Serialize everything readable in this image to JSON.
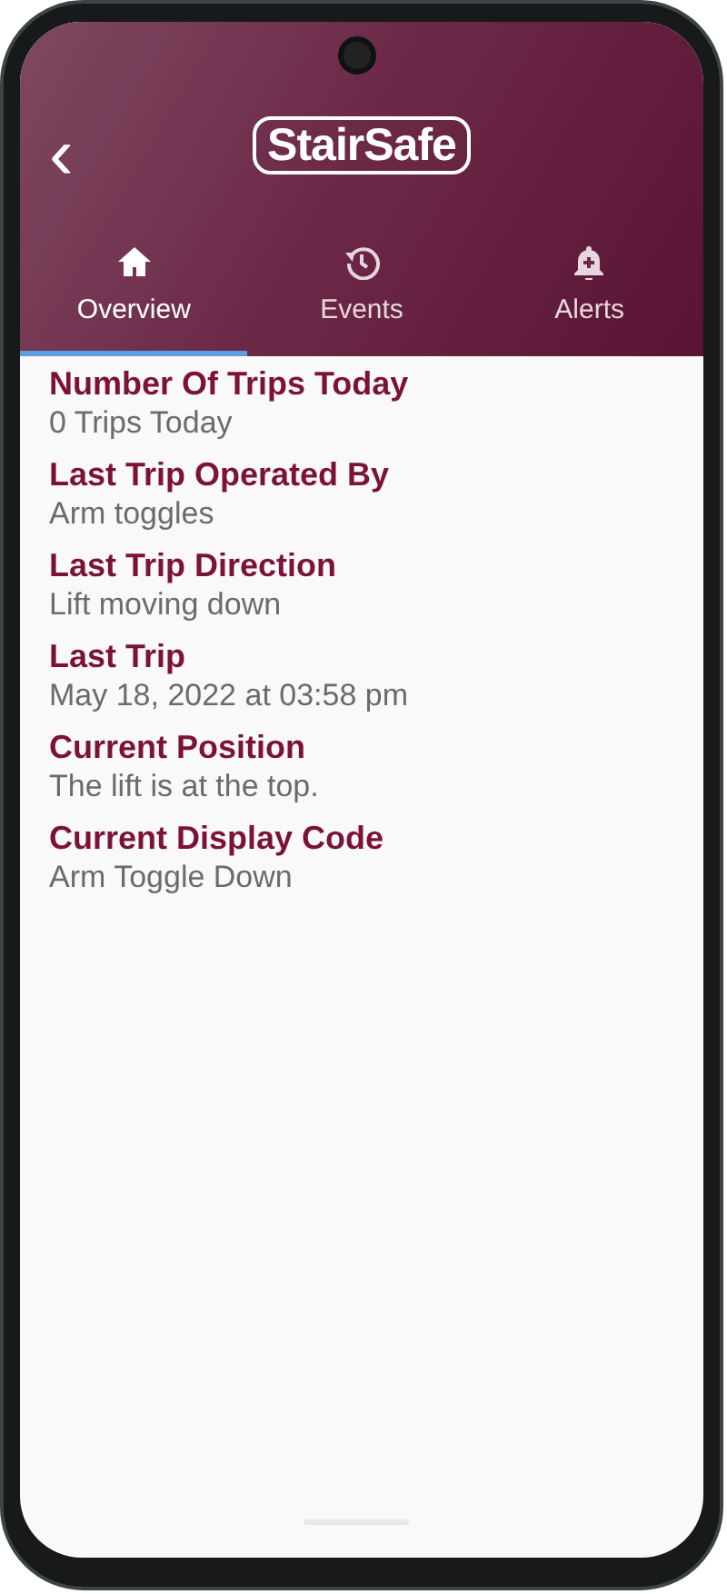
{
  "header": {
    "back": "‹",
    "logo": "StairSafe"
  },
  "tabs": [
    {
      "kind": "home",
      "label": "Overview",
      "selected": true
    },
    {
      "kind": "history",
      "label": "Events",
      "selected": false
    },
    {
      "kind": "bell",
      "label": "Alerts",
      "selected": false
    }
  ],
  "details": [
    {
      "label": "Number Of Trips Today",
      "value": "0 Trips Today"
    },
    {
      "label": "Last Trip Operated By",
      "value": "Arm toggles"
    },
    {
      "label": "Last Trip Direction",
      "value": "Lift moving down"
    },
    {
      "label": "Last Trip",
      "value": "May 18, 2022 at 03:58 pm"
    },
    {
      "label": "Current Position",
      "value": "The lift is at the top."
    },
    {
      "label": "Current Display Code",
      "value": "Arm Toggle Down"
    }
  ]
}
